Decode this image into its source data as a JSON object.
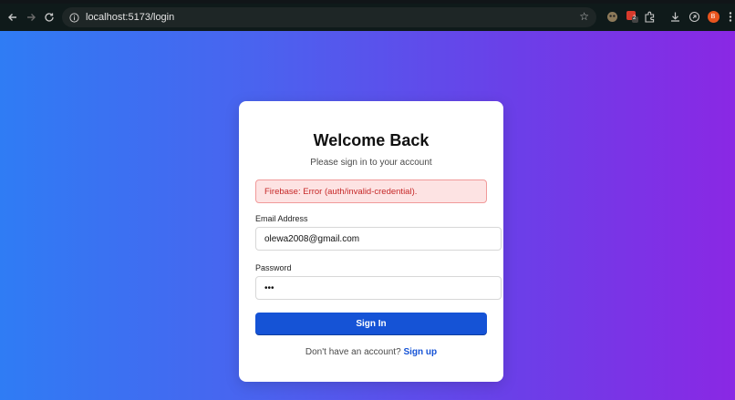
{
  "browser": {
    "url": "localhost:5173/login",
    "extension_badge": "2",
    "profile_initial": "B"
  },
  "colors": {
    "gradient_start": "#2f7cf4",
    "gradient_end": "#8a28e4",
    "primary": "#1553d6",
    "error_text": "#c62828",
    "error_bg": "#fde3e3"
  },
  "login": {
    "title": "Welcome Back",
    "subtitle": "Please sign in to your account",
    "error_message": "Firebase: Error (auth/invalid-credential).",
    "email_label": "Email Address",
    "email_value": "olewa2008@gmail.com",
    "password_label": "Password",
    "password_value": "•••",
    "submit_label": "Sign In",
    "footer_prompt": "Don't have an account?",
    "signup_link": "Sign up"
  }
}
